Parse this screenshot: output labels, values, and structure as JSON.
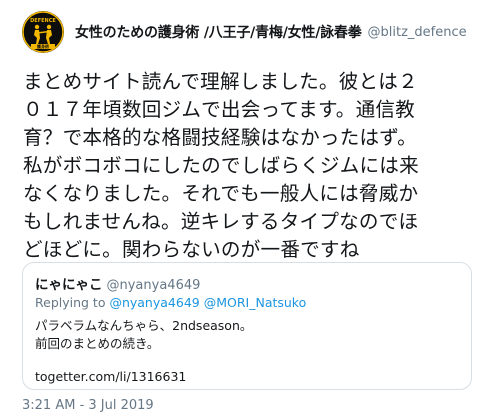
{
  "author": {
    "display_name": "女性のための護身術 /八王子/青梅/女性/詠春拳",
    "handle": "@blitz_defence",
    "avatar_icon": "martial-arts-logo-icon",
    "avatar_text_top": "DEFENCE",
    "avatar_text_bottom": "護身術"
  },
  "tweet": {
    "lines": [
      "まとめサイト読んで理解しました。彼とは２",
      "０１７年頃数回ジムで出会ってます。通信教",
      "育？で本格的な格闘技経験はなかったはず。",
      "私がボコボコにしたのでしばらくジムには来",
      "なくなりました。それでも一般人には脅威か",
      "もしれませんね。逆キレするタイプなのでほ",
      "どほどに。関わらないのが一番ですね"
    ],
    "timestamp": "3:21 AM - 3 Jul 2019"
  },
  "quote": {
    "name": "にゃにゃこ",
    "handle": "@nyanya4649",
    "replying_prefix": "Replying to ",
    "replying_to": [
      "@nyanya4649",
      "@MORI_Natsuko"
    ],
    "text_lines": [
      "パラベラムなんちゃら、2ndseason。",
      "前回のまとめの続き。"
    ],
    "url": "togetter.com/li/1316631"
  },
  "colors": {
    "text": "#14171a",
    "secondary": "#657786",
    "link": "#1b95e0",
    "border": "#d8dfe4",
    "avatar_accent": "#f5b800"
  }
}
